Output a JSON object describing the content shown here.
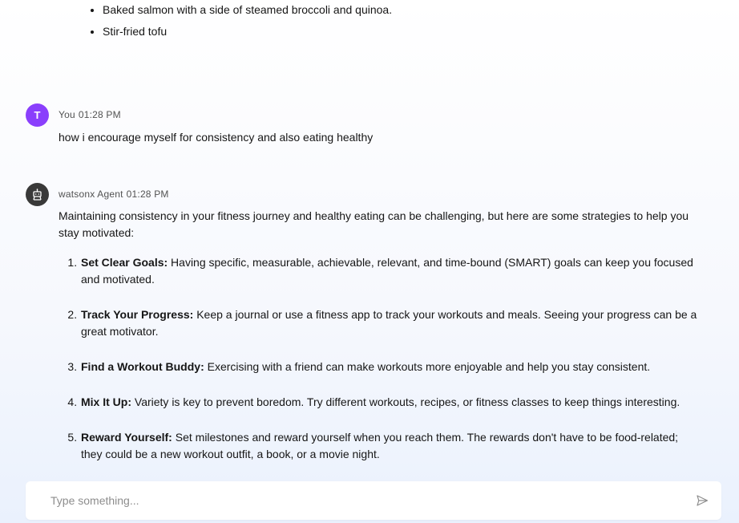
{
  "previous_message": {
    "items": [
      "Baked salmon with a side of steamed broccoli and quinoa.",
      "Stir-fried tofu"
    ]
  },
  "user_message": {
    "avatar_letter": "T",
    "sender": "You",
    "time": "01:28 PM",
    "text": "how i encourage myself for consistency and also eating healthy",
    "avatar_color": "#8a3ffc"
  },
  "agent_message": {
    "sender": "watsonx Agent",
    "time": "01:28 PM",
    "avatar_icon": "robot-icon",
    "intro": "Maintaining consistency in your fitness journey and healthy eating can be challenging, but here are some strategies to help you stay motivated:",
    "tips": [
      {
        "title": "Set Clear Goals:",
        "text": " Having specific, measurable, achievable, relevant, and time-bound (SMART) goals can keep you focused and motivated."
      },
      {
        "title": "Track Your Progress:",
        "text": " Keep a journal or use a fitness app to track your workouts and meals. Seeing your progress can be a great motivator."
      },
      {
        "title": "Find a Workout Buddy:",
        "text": " Exercising with a friend can make workouts more enjoyable and help you stay consistent."
      },
      {
        "title": "Mix It Up:",
        "text": " Variety is key to prevent boredom. Try different workouts, recipes, or fitness classes to keep things interesting."
      },
      {
        "title": "Reward Yourself:",
        "text": " Set milestones and reward yourself when you reach them. The rewards don't have to be food-related; they could be a new workout outfit, a book, or a movie night."
      }
    ]
  },
  "composer": {
    "placeholder": "Type something...",
    "value": "",
    "send_icon": "send-icon"
  }
}
